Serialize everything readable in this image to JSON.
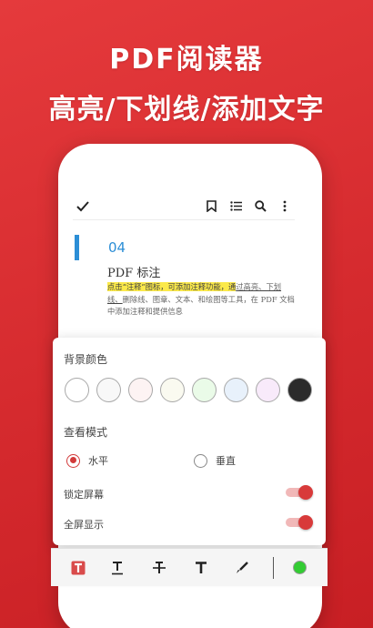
{
  "promo": {
    "title": "PDF阅读器",
    "subtitle": "高亮/下划线/添加文字"
  },
  "toolbar": {
    "icons": [
      "check-icon",
      "bookmark-icon",
      "list-icon",
      "search-icon",
      "more-icon"
    ]
  },
  "document": {
    "section_number": "04",
    "section_title": "PDF 标注",
    "body_highlight": "点击“注释”图标，可添加注释功能，通",
    "body_underline": "过高亮、下划线、",
    "body_strike": "删除线、图章、文本、",
    "body_rest": "和绘图等工具，在 PDF 文档中添加注释和提供信息"
  },
  "settings": {
    "bg_color_label": "背景颜色",
    "colors": [
      "#ffffff",
      "#f8f8f8",
      "#fdf3f3",
      "#fafaf0",
      "#eafbe8",
      "#e8f1fb",
      "#f8eafa",
      "#2b2b2b"
    ],
    "view_mode_label": "查看模式",
    "view_modes": [
      {
        "label": "水平",
        "selected": true
      },
      {
        "label": "垂直",
        "selected": false
      }
    ],
    "lock_screen_label": "锁定屏幕",
    "lock_screen_on": true,
    "fullscreen_label": "全屏显示",
    "fullscreen_on": true,
    "accent": "#d83a3a"
  },
  "annotation_bar": {
    "tools": [
      "highlight-tool",
      "underline-tool",
      "strikethrough-tool",
      "text-tool",
      "pen-tool"
    ],
    "current_color": "#33cc33"
  }
}
